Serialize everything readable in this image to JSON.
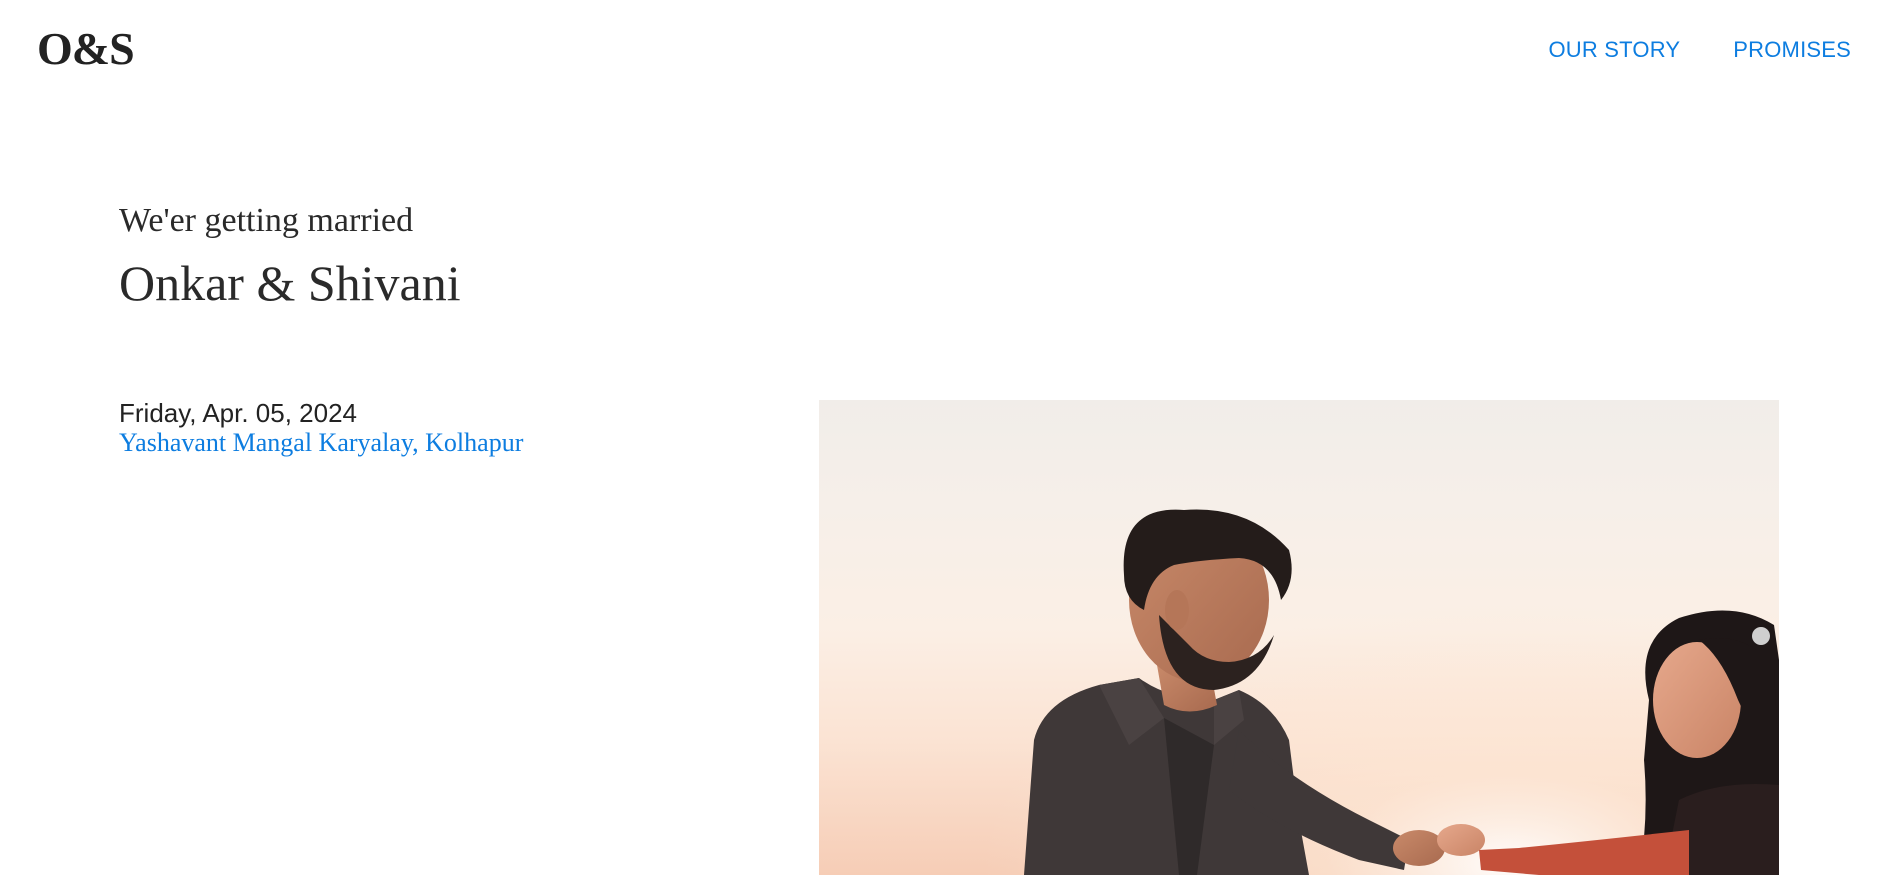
{
  "header": {
    "logo": "O&S",
    "nav": [
      {
        "label": "OUR STORY"
      },
      {
        "label": "PROMISES"
      }
    ]
  },
  "hero": {
    "tagline": "We'er getting married",
    "names": "Onkar & Shivani"
  },
  "event": {
    "date": "Friday, Apr. 05, 2024",
    "venue": "Yashavant Mangal Karyalay, Kolhapur"
  },
  "colors": {
    "accent": "#0d7de0",
    "text": "#222222",
    "background": "#ffffff"
  }
}
